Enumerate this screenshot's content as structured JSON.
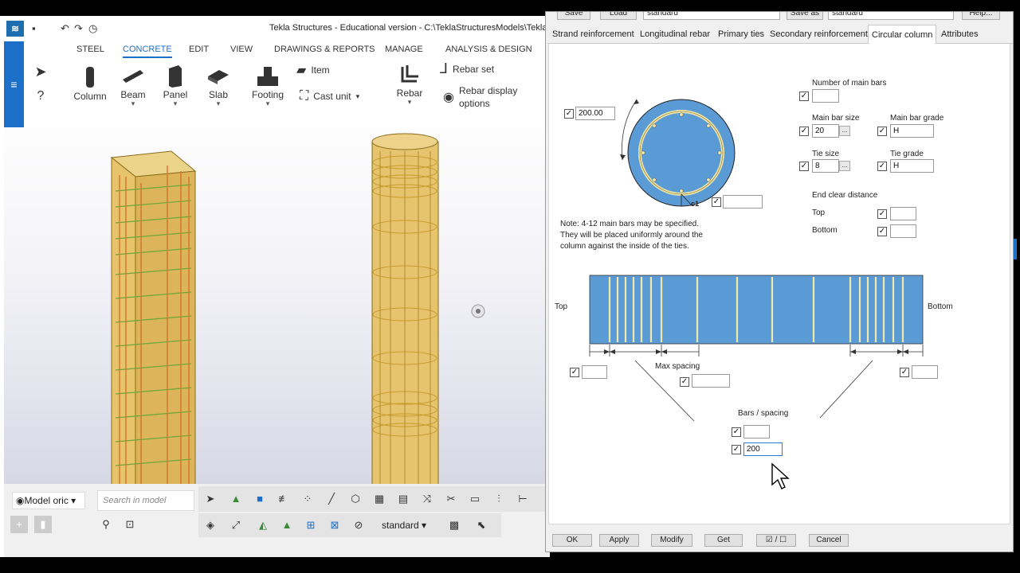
{
  "app": {
    "title": "Tekla Structures - Educational version - C:\\TeklaStructuresModels\\Tekla Ta",
    "logo": "tekla-logo",
    "tabs": [
      "STEEL",
      "CONCRETE",
      "EDIT",
      "VIEW",
      "DRAWINGS & REPORTS",
      "MANAGE",
      "ANALYSIS & DESIGN"
    ],
    "active_tab": "CONCRETE",
    "ribbon": {
      "column": "Column",
      "beam": "Beam",
      "panel": "Panel",
      "slab": "Slab",
      "footing": "Footing",
      "item": "Item",
      "cast_unit": "Cast unit",
      "rebar": "Rebar",
      "rebar_set": "Rebar set",
      "rebar_display_1": "Rebar display",
      "rebar_display_2": "options"
    },
    "bottom": {
      "model_origin": "Model oric",
      "search_placeholder": "Search in model",
      "standard": "standard"
    },
    "colors": {
      "accent": "#1d70c9",
      "column_fill": "#e6c46e",
      "rebar_green": "#6aa83a",
      "rebar_orange": "#d2742a"
    }
  },
  "dialog": {
    "top_buttons": [
      "Save",
      "Load",
      "Save as",
      "Help..."
    ],
    "top_preset": "standard",
    "top_saveas_value": "standard",
    "tabs": [
      "Strand reinforcement",
      "Longitudinal rebar",
      "Primary ties",
      "Secondary reinforcement",
      "Circular column",
      "Attributes"
    ],
    "active_tab": "Circular column",
    "diameter_value": "200.00",
    "c1_label": "c1",
    "c1_value": "",
    "note_lines": [
      "Note: 4-12 main bars may be specified.",
      "They will be placed uniformly around the",
      "column against the inside of the ties."
    ],
    "number_of_main_bars_label": "Number of main bars",
    "number_of_main_bars_value": "",
    "main_bar_size_label": "Main bar size",
    "main_bar_size_value": "20",
    "main_bar_grade_label": "Main bar grade",
    "main_bar_grade_value": "H",
    "tie_size_label": "Tie size",
    "tie_size_value": "8",
    "tie_grade_label": "Tie grade",
    "tie_grade_value": "H",
    "dots_label": "...",
    "end_clear_distance_label": "End clear distance",
    "top_label": "Top",
    "bottom_label": "Bottom",
    "end_top_value": "",
    "end_bottom_value": "",
    "diagram_top": "Top",
    "diagram_bottom": "Bottom",
    "max_spacing_label": "Max spacing",
    "left_end_value": "",
    "max_spacing_value": "",
    "right_end_value": "",
    "bars_spacing_label": "Bars / spacing",
    "bars_value": "",
    "spacing_value": "200",
    "footer_buttons": [
      "OK",
      "Apply",
      "Modify",
      "Get",
      "Cancel"
    ],
    "toggle_label": "☑ / ☐",
    "colors": {
      "section_fill": "#5b9bd5",
      "tie_ring": "#f0e6a8"
    }
  }
}
